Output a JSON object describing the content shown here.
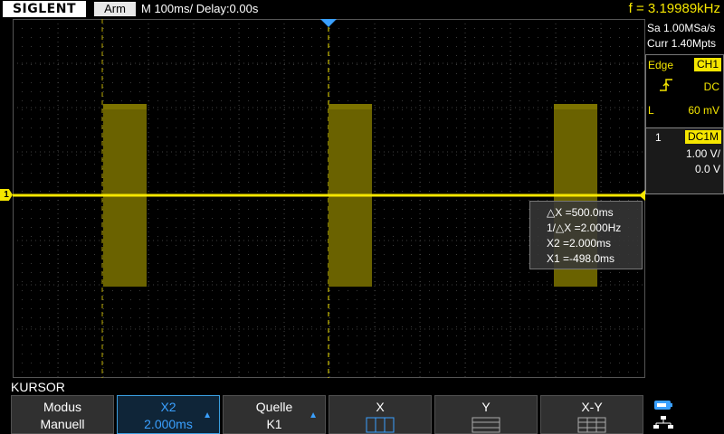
{
  "brand": "SIGLENT",
  "topbar": {
    "status": "Arm",
    "timebase": "M 100ms/",
    "delay": "Delay:0.00s",
    "frequency": "f = 3.19989kHz"
  },
  "acquisition": {
    "sample_rate": "Sa 1.00MSa/s",
    "memory_depth": "Curr 1.40Mpts"
  },
  "trigger": {
    "type": "Edge",
    "source": "CH1",
    "coupling": "DC",
    "slope_icon": "rising-edge-icon",
    "level_label": "L",
    "level": "60 mV"
  },
  "channel": {
    "number": "1",
    "coupling": "DC1M",
    "scale": "1.00 V/",
    "offset": "0.0 V",
    "marker": "1",
    "color": "#f5e600"
  },
  "cursor_readout": {
    "delta_x": "△X =500.0ms",
    "inv_delta_x": "1/△X =2.000Hz",
    "x2": "X2 =2.000ms",
    "x1": "X1 =-498.0ms"
  },
  "menu": {
    "title": "KURSOR",
    "buttons": [
      {
        "line1": "Modus",
        "line2": "Manuell"
      },
      {
        "line1": "X2",
        "line2": "2.000ms"
      },
      {
        "line1": "Quelle",
        "line2": "K1"
      },
      {
        "line1": "X",
        "icon": "cursor-x-icon"
      },
      {
        "line1": "Y",
        "icon": "cursor-y-icon"
      },
      {
        "line1": "X-Y",
        "icon": "cursor-xy-icon"
      }
    ]
  },
  "colors": {
    "accent": "#3aa0ff",
    "trace": "#f5e600",
    "cursor": "#b8a800"
  }
}
